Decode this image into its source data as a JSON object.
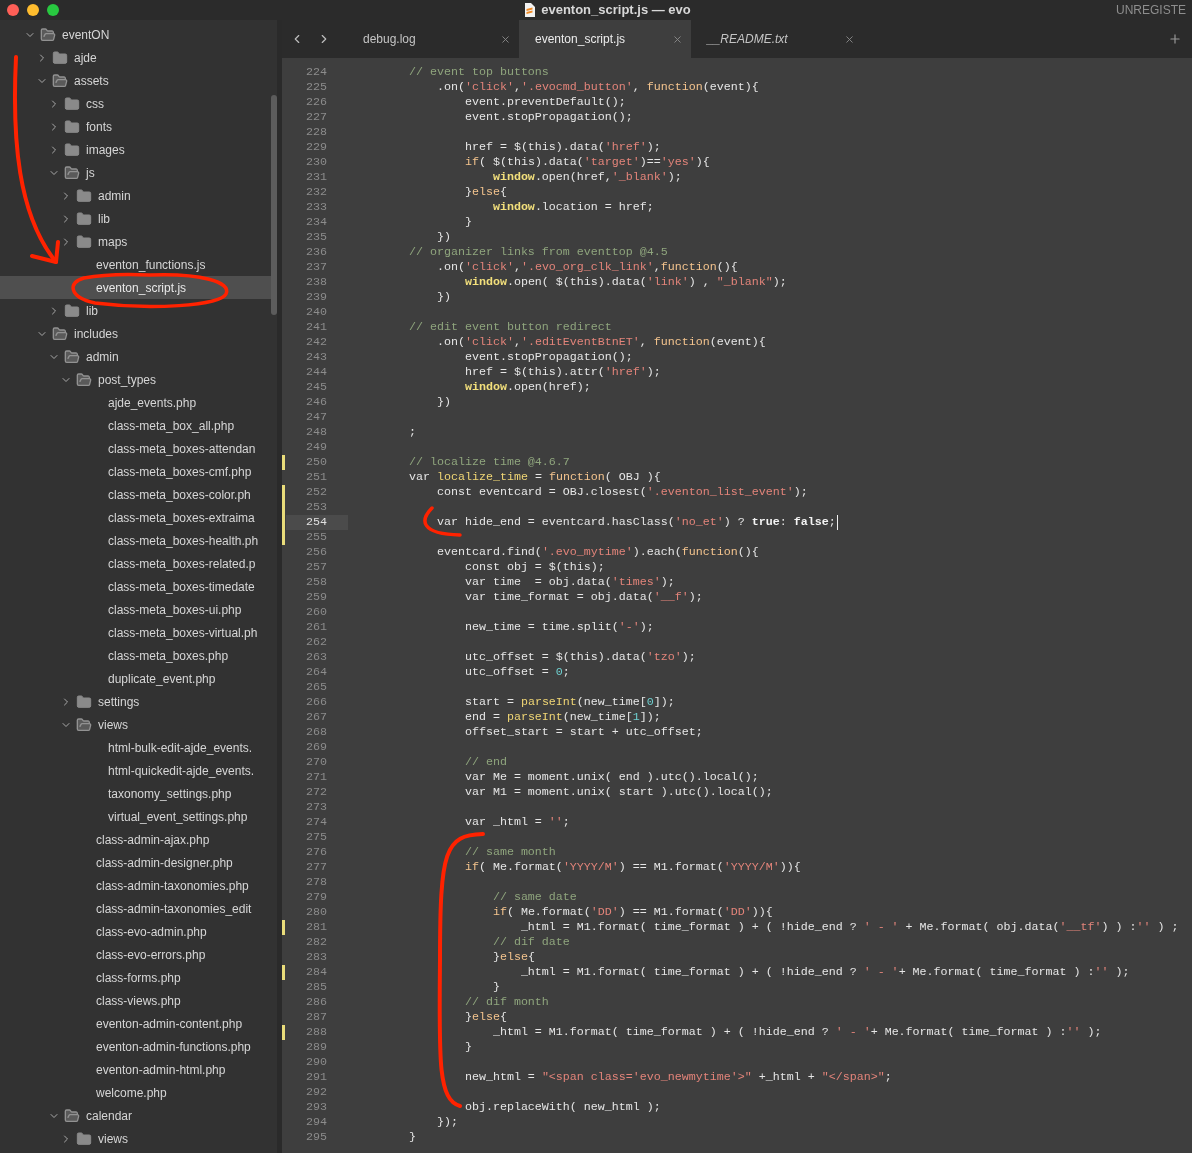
{
  "window": {
    "title": "eventon_script.js — evo",
    "license_notice": "UNREGISTE"
  },
  "tabs": [
    {
      "label": "debug.log",
      "selected": false,
      "preview": false
    },
    {
      "label": "eventon_script.js",
      "selected": true,
      "preview": false
    },
    {
      "label": "__README.txt",
      "selected": false,
      "preview": true
    }
  ],
  "sidebar": {
    "tree": [
      {
        "kind": "folder",
        "label": "eventON",
        "expanded": true,
        "selected": false,
        "children": [
          {
            "kind": "folder",
            "label": "ajde",
            "expanded": false,
            "selected": false
          },
          {
            "kind": "folder",
            "label": "assets",
            "expanded": true,
            "selected": false,
            "children": [
              {
                "kind": "folder",
                "label": "css",
                "expanded": false,
                "selected": false
              },
              {
                "kind": "folder",
                "label": "fonts",
                "expanded": false,
                "selected": false
              },
              {
                "kind": "folder",
                "label": "images",
                "expanded": false,
                "selected": false
              },
              {
                "kind": "folder",
                "label": "js",
                "expanded": true,
                "selected": false,
                "children": [
                  {
                    "kind": "folder",
                    "label": "admin",
                    "expanded": false,
                    "selected": false
                  },
                  {
                    "kind": "folder",
                    "label": "lib",
                    "expanded": false,
                    "selected": false
                  },
                  {
                    "kind": "folder",
                    "label": "maps",
                    "expanded": false,
                    "selected": false
                  },
                  {
                    "kind": "file",
                    "label": "eventon_functions.js",
                    "selected": false
                  },
                  {
                    "kind": "file",
                    "label": "eventon_script.js",
                    "selected": true
                  }
                ]
              },
              {
                "kind": "folder",
                "label": "lib",
                "expanded": false,
                "selected": false
              }
            ]
          },
          {
            "kind": "folder",
            "label": "includes",
            "expanded": true,
            "selected": false,
            "children": [
              {
                "kind": "folder",
                "label": "admin",
                "expanded": true,
                "selected": false,
                "children": [
                  {
                    "kind": "folder",
                    "label": "post_types",
                    "expanded": true,
                    "selected": false,
                    "children": [
                      {
                        "kind": "file",
                        "label": "ajde_events.php",
                        "selected": false
                      },
                      {
                        "kind": "file",
                        "label": "class-meta_box_all.php",
                        "selected": false
                      },
                      {
                        "kind": "file",
                        "label": "class-meta_boxes-attendan",
                        "selected": false
                      },
                      {
                        "kind": "file",
                        "label": "class-meta_boxes-cmf.php",
                        "selected": false
                      },
                      {
                        "kind": "file",
                        "label": "class-meta_boxes-color.ph",
                        "selected": false
                      },
                      {
                        "kind": "file",
                        "label": "class-meta_boxes-extraima",
                        "selected": false
                      },
                      {
                        "kind": "file",
                        "label": "class-meta_boxes-health.ph",
                        "selected": false
                      },
                      {
                        "kind": "file",
                        "label": "class-meta_boxes-related.p",
                        "selected": false
                      },
                      {
                        "kind": "file",
                        "label": "class-meta_boxes-timedate",
                        "selected": false
                      },
                      {
                        "kind": "file",
                        "label": "class-meta_boxes-ui.php",
                        "selected": false
                      },
                      {
                        "kind": "file",
                        "label": "class-meta_boxes-virtual.ph",
                        "selected": false
                      },
                      {
                        "kind": "file",
                        "label": "class-meta_boxes.php",
                        "selected": false
                      },
                      {
                        "kind": "file",
                        "label": "duplicate_event.php",
                        "selected": false
                      }
                    ]
                  },
                  {
                    "kind": "folder",
                    "label": "settings",
                    "expanded": false,
                    "selected": false
                  },
                  {
                    "kind": "folder",
                    "label": "views",
                    "expanded": true,
                    "selected": false,
                    "children": [
                      {
                        "kind": "file",
                        "label": "html-bulk-edit-ajde_events.",
                        "selected": false
                      },
                      {
                        "kind": "file",
                        "label": "html-quickedit-ajde_events.",
                        "selected": false
                      },
                      {
                        "kind": "file",
                        "label": "taxonomy_settings.php",
                        "selected": false
                      },
                      {
                        "kind": "file",
                        "label": "virtual_event_settings.php",
                        "selected": false
                      }
                    ]
                  },
                  {
                    "kind": "file",
                    "label": "class-admin-ajax.php",
                    "selected": false
                  },
                  {
                    "kind": "file",
                    "label": "class-admin-designer.php",
                    "selected": false
                  },
                  {
                    "kind": "file",
                    "label": "class-admin-taxonomies.php",
                    "selected": false
                  },
                  {
                    "kind": "file",
                    "label": "class-admin-taxonomies_edit",
                    "selected": false
                  },
                  {
                    "kind": "file",
                    "label": "class-evo-admin.php",
                    "selected": false
                  },
                  {
                    "kind": "file",
                    "label": "class-evo-errors.php",
                    "selected": false
                  },
                  {
                    "kind": "file",
                    "label": "class-forms.php",
                    "selected": false
                  },
                  {
                    "kind": "file",
                    "label": "class-views.php",
                    "selected": false
                  },
                  {
                    "kind": "file",
                    "label": "eventon-admin-content.php",
                    "selected": false
                  },
                  {
                    "kind": "file",
                    "label": "eventon-admin-functions.php",
                    "selected": false
                  },
                  {
                    "kind": "file",
                    "label": "eventon-admin-html.php",
                    "selected": false
                  },
                  {
                    "kind": "file",
                    "label": "welcome.php",
                    "selected": false
                  }
                ]
              },
              {
                "kind": "folder",
                "label": "calendar",
                "expanded": true,
                "selected": false,
                "children": [
                  {
                    "kind": "folder",
                    "label": "views",
                    "expanded": false,
                    "selected": false
                  }
                ]
              }
            ]
          }
        ]
      }
    ]
  },
  "editor": {
    "lines": [
      {
        "number": "224",
        "modified": false,
        "selected": false,
        "tokens": [
          {
            "text": "        // event top buttons",
            "kind": "comment"
          }
        ]
      },
      {
        "number": "225",
        "modified": false,
        "selected": false,
        "tokens": [
          {
            "text": "            .on(",
            "kind": "plain"
          },
          {
            "text": "'click'",
            "kind": "string"
          },
          {
            "text": ",",
            "kind": "plain"
          },
          {
            "text": "'.evocmd_button'",
            "kind": "string"
          },
          {
            "text": ", ",
            "kind": "plain"
          },
          {
            "text": "function",
            "kind": "keyword"
          },
          {
            "text": "(event){",
            "kind": "plain"
          }
        ]
      },
      {
        "number": "226",
        "modified": false,
        "selected": false,
        "tokens": [
          {
            "text": "                event.preventDefault();",
            "kind": "plain"
          }
        ]
      },
      {
        "number": "227",
        "modified": false,
        "selected": false,
        "tokens": [
          {
            "text": "                event.stopPropagation();",
            "kind": "plain"
          }
        ]
      },
      {
        "number": "228",
        "modified": false,
        "selected": false
      },
      {
        "number": "229",
        "modified": false,
        "selected": false,
        "tokens": [
          {
            "text": "                href = $(this).data(",
            "kind": "plain"
          },
          {
            "text": "'href'",
            "kind": "string"
          },
          {
            "text": ");",
            "kind": "plain"
          }
        ]
      },
      {
        "number": "230",
        "modified": false,
        "selected": false,
        "tokens": [
          {
            "text": "                if",
            "kind": "keyword"
          },
          {
            "text": "( $(this).data(",
            "kind": "plain"
          },
          {
            "text": "'target'",
            "kind": "string"
          },
          {
            "text": ")==",
            "kind": "plain"
          },
          {
            "text": "'yes'",
            "kind": "string"
          },
          {
            "text": "){",
            "kind": "plain"
          }
        ]
      },
      {
        "number": "231",
        "modified": false,
        "selected": false,
        "tokens": [
          {
            "text": "                    window",
            "kind": "builtin"
          },
          {
            "text": ".open(href,",
            "kind": "plain"
          },
          {
            "text": "'_blank'",
            "kind": "string"
          },
          {
            "text": ");",
            "kind": "plain"
          }
        ]
      },
      {
        "number": "232",
        "modified": false,
        "selected": false,
        "tokens": [
          {
            "text": "                }",
            "kind": "plain"
          },
          {
            "text": "else",
            "kind": "keyword"
          },
          {
            "text": "{",
            "kind": "plain"
          }
        ]
      },
      {
        "number": "233",
        "modified": false,
        "selected": false,
        "tokens": [
          {
            "text": "                    window",
            "kind": "builtin"
          },
          {
            "text": ".location = href;",
            "kind": "plain"
          }
        ]
      },
      {
        "number": "234",
        "modified": false,
        "selected": false,
        "tokens": [
          {
            "text": "                }",
            "kind": "plain"
          }
        ]
      },
      {
        "number": "235",
        "modified": false,
        "selected": false,
        "tokens": [
          {
            "text": "            })",
            "kind": "plain"
          }
        ]
      },
      {
        "number": "236",
        "modified": false,
        "selected": false,
        "tokens": [
          {
            "text": "        // organizer links from eventtop @4.5",
            "kind": "comment"
          }
        ]
      },
      {
        "number": "237",
        "modified": false,
        "selected": false,
        "tokens": [
          {
            "text": "            .on(",
            "kind": "plain"
          },
          {
            "text": "'click'",
            "kind": "string"
          },
          {
            "text": ",",
            "kind": "plain"
          },
          {
            "text": "'.evo_org_clk_link'",
            "kind": "string"
          },
          {
            "text": ",",
            "kind": "plain"
          },
          {
            "text": "function",
            "kind": "keyword"
          },
          {
            "text": "(){",
            "kind": "plain"
          }
        ]
      },
      {
        "number": "238",
        "modified": false,
        "selected": false,
        "tokens": [
          {
            "text": "                window",
            "kind": "builtin"
          },
          {
            "text": ".open( $(this).data(",
            "kind": "plain"
          },
          {
            "text": "'link'",
            "kind": "string"
          },
          {
            "text": ") , ",
            "kind": "plain"
          },
          {
            "text": "\"_blank\"",
            "kind": "string"
          },
          {
            "text": ");",
            "kind": "plain"
          }
        ]
      },
      {
        "number": "239",
        "modified": false,
        "selected": false,
        "tokens": [
          {
            "text": "            })",
            "kind": "plain"
          }
        ]
      },
      {
        "number": "240",
        "modified": false,
        "selected": false
      },
      {
        "number": "241",
        "modified": false,
        "selected": false,
        "tokens": [
          {
            "text": "        // edit event button redirect",
            "kind": "comment"
          }
        ]
      },
      {
        "number": "242",
        "modified": false,
        "selected": false,
        "tokens": [
          {
            "text": "            .on(",
            "kind": "plain"
          },
          {
            "text": "'click'",
            "kind": "string"
          },
          {
            "text": ",",
            "kind": "plain"
          },
          {
            "text": "'.editEventBtnET'",
            "kind": "string"
          },
          {
            "text": ", ",
            "kind": "plain"
          },
          {
            "text": "function",
            "kind": "keyword"
          },
          {
            "text": "(event){",
            "kind": "plain"
          }
        ]
      },
      {
        "number": "243",
        "modified": false,
        "selected": false,
        "tokens": [
          {
            "text": "                event.stopPropagation();",
            "kind": "plain"
          }
        ]
      },
      {
        "number": "244",
        "modified": false,
        "selected": false,
        "tokens": [
          {
            "text": "                href = $(this).attr(",
            "kind": "plain"
          },
          {
            "text": "'href'",
            "kind": "string"
          },
          {
            "text": ");",
            "kind": "plain"
          }
        ]
      },
      {
        "number": "245",
        "modified": false,
        "selected": false,
        "tokens": [
          {
            "text": "                window",
            "kind": "builtin"
          },
          {
            "text": ".open(href);",
            "kind": "plain"
          }
        ]
      },
      {
        "number": "246",
        "modified": false,
        "selected": false,
        "tokens": [
          {
            "text": "            })",
            "kind": "plain"
          }
        ]
      },
      {
        "number": "247",
        "modified": false,
        "selected": false
      },
      {
        "number": "248",
        "modified": false,
        "selected": false,
        "tokens": [
          {
            "text": "        ;",
            "kind": "plain"
          }
        ]
      },
      {
        "number": "249",
        "modified": false,
        "selected": false
      },
      {
        "number": "250",
        "modified": true,
        "selected": false,
        "tokens": [
          {
            "text": "        // localize time @4.6.7",
            "kind": "comment"
          }
        ]
      },
      {
        "number": "251",
        "modified": false,
        "selected": false,
        "tokens": [
          {
            "text": "        var ",
            "kind": "plain"
          },
          {
            "text": "localize_time",
            "kind": "function"
          },
          {
            "text": " = ",
            "kind": "plain"
          },
          {
            "text": "function",
            "kind": "keyword"
          },
          {
            "text": "( OBJ ){",
            "kind": "plain"
          }
        ]
      },
      {
        "number": "252",
        "modified": true,
        "selected": false,
        "tokens": [
          {
            "text": "            const eventcard = OBJ.closest(",
            "kind": "plain"
          },
          {
            "text": "'.eventon_list_event'",
            "kind": "string"
          },
          {
            "text": ");",
            "kind": "plain"
          }
        ]
      },
      {
        "number": "253",
        "modified": true,
        "selected": false
      },
      {
        "number": "254",
        "modified": true,
        "selected": true,
        "tokens": [
          {
            "text": "            var hide_end = eventcard.hasClass(",
            "kind": "plain"
          },
          {
            "text": "'no_et'",
            "kind": "string"
          },
          {
            "text": ") ? ",
            "kind": "plain"
          },
          {
            "text": "true",
            "kind": "constant"
          },
          {
            "text": ": ",
            "kind": "plain"
          },
          {
            "text": "false",
            "kind": "constant"
          },
          {
            "text": ";",
            "kind": "plain"
          }
        ]
      },
      {
        "number": "255",
        "modified": true,
        "selected": false
      },
      {
        "number": "256",
        "modified": false,
        "selected": false,
        "tokens": [
          {
            "text": "            eventcard.find(",
            "kind": "plain"
          },
          {
            "text": "'.evo_mytime'",
            "kind": "string"
          },
          {
            "text": ").each(",
            "kind": "plain"
          },
          {
            "text": "function",
            "kind": "keyword"
          },
          {
            "text": "(){",
            "kind": "plain"
          }
        ]
      },
      {
        "number": "257",
        "modified": false,
        "selected": false,
        "tokens": [
          {
            "text": "                const obj = $(this);",
            "kind": "plain"
          }
        ]
      },
      {
        "number": "258",
        "modified": false,
        "selected": false,
        "tokens": [
          {
            "text": "                var time  = obj.data(",
            "kind": "plain"
          },
          {
            "text": "'times'",
            "kind": "string"
          },
          {
            "text": ");",
            "kind": "plain"
          }
        ]
      },
      {
        "number": "259",
        "modified": false,
        "selected": false,
        "tokens": [
          {
            "text": "                var time_format = obj.data(",
            "kind": "plain"
          },
          {
            "text": "'__f'",
            "kind": "string"
          },
          {
            "text": ");",
            "kind": "plain"
          }
        ]
      },
      {
        "number": "260",
        "modified": false,
        "selected": false
      },
      {
        "number": "261",
        "modified": false,
        "selected": false,
        "tokens": [
          {
            "text": "                new_time = time.split(",
            "kind": "plain"
          },
          {
            "text": "'-'",
            "kind": "string"
          },
          {
            "text": ");",
            "kind": "plain"
          }
        ]
      },
      {
        "number": "262",
        "modified": false,
        "selected": false
      },
      {
        "number": "263",
        "modified": false,
        "selected": false,
        "tokens": [
          {
            "text": "                utc_offset = $(this).data(",
            "kind": "plain"
          },
          {
            "text": "'tzo'",
            "kind": "string"
          },
          {
            "text": ");",
            "kind": "plain"
          }
        ]
      },
      {
        "number": "264",
        "modified": false,
        "selected": false,
        "tokens": [
          {
            "text": "                utc_offset = ",
            "kind": "plain"
          },
          {
            "text": "0",
            "kind": "number"
          },
          {
            "text": ";",
            "kind": "plain"
          }
        ]
      },
      {
        "number": "265",
        "modified": false,
        "selected": false
      },
      {
        "number": "266",
        "modified": false,
        "selected": false,
        "tokens": [
          {
            "text": "                start = ",
            "kind": "plain"
          },
          {
            "text": "parseInt",
            "kind": "function"
          },
          {
            "text": "(new_time[",
            "kind": "plain"
          },
          {
            "text": "0",
            "kind": "number"
          },
          {
            "text": "]);",
            "kind": "plain"
          }
        ]
      },
      {
        "number": "267",
        "modified": false,
        "selected": false,
        "tokens": [
          {
            "text": "                end = ",
            "kind": "plain"
          },
          {
            "text": "parseInt",
            "kind": "function"
          },
          {
            "text": "(new_time[",
            "kind": "plain"
          },
          {
            "text": "1",
            "kind": "number"
          },
          {
            "text": "]);",
            "kind": "plain"
          }
        ]
      },
      {
        "number": "268",
        "modified": false,
        "selected": false,
        "tokens": [
          {
            "text": "                offset_start = start + utc_offset;",
            "kind": "plain"
          }
        ]
      },
      {
        "number": "269",
        "modified": false,
        "selected": false
      },
      {
        "number": "270",
        "modified": false,
        "selected": false,
        "tokens": [
          {
            "text": "                // end",
            "kind": "comment"
          }
        ]
      },
      {
        "number": "271",
        "modified": false,
        "selected": false,
        "tokens": [
          {
            "text": "                var Me = moment.unix( end ).utc().local();",
            "kind": "plain"
          }
        ]
      },
      {
        "number": "272",
        "modified": false,
        "selected": false,
        "tokens": [
          {
            "text": "                var M1 = moment.unix( start ).utc().local();",
            "kind": "plain"
          }
        ]
      },
      {
        "number": "273",
        "modified": false,
        "selected": false
      },
      {
        "number": "274",
        "modified": false,
        "selected": false,
        "tokens": [
          {
            "text": "                var _html = ",
            "kind": "plain"
          },
          {
            "text": "''",
            "kind": "string"
          },
          {
            "text": ";",
            "kind": "plain"
          }
        ]
      },
      {
        "number": "275",
        "modified": false,
        "selected": false
      },
      {
        "number": "276",
        "modified": false,
        "selected": false,
        "tokens": [
          {
            "text": "                // same month",
            "kind": "comment"
          }
        ]
      },
      {
        "number": "277",
        "modified": false,
        "selected": false,
        "tokens": [
          {
            "text": "                if",
            "kind": "keyword"
          },
          {
            "text": "( Me.format(",
            "kind": "plain"
          },
          {
            "text": "'YYYY/M'",
            "kind": "string"
          },
          {
            "text": ") == M1.format(",
            "kind": "plain"
          },
          {
            "text": "'YYYY/M'",
            "kind": "string"
          },
          {
            "text": ")){",
            "kind": "plain"
          }
        ]
      },
      {
        "number": "278",
        "modified": false,
        "selected": false
      },
      {
        "number": "279",
        "modified": false,
        "selected": false,
        "tokens": [
          {
            "text": "                    // same date",
            "kind": "comment"
          }
        ]
      },
      {
        "number": "280",
        "modified": false,
        "selected": false,
        "tokens": [
          {
            "text": "                    if",
            "kind": "keyword"
          },
          {
            "text": "( Me.format(",
            "kind": "plain"
          },
          {
            "text": "'DD'",
            "kind": "string"
          },
          {
            "text": ") == M1.format(",
            "kind": "plain"
          },
          {
            "text": "'DD'",
            "kind": "string"
          },
          {
            "text": ")){",
            "kind": "plain"
          }
        ]
      },
      {
        "number": "281",
        "modified": true,
        "selected": false,
        "tokens": [
          {
            "text": "                        _html = M1.format( time_format ) + ( !hide_end ? ",
            "kind": "plain"
          },
          {
            "text": "' - '",
            "kind": "string"
          },
          {
            "text": " + Me.format( obj.data(",
            "kind": "plain"
          },
          {
            "text": "'__tf'",
            "kind": "string"
          },
          {
            "text": ") ) :",
            "kind": "plain"
          },
          {
            "text": "''",
            "kind": "string"
          },
          {
            "text": " ) ;",
            "kind": "plain"
          }
        ]
      },
      {
        "number": "282",
        "modified": false,
        "selected": false,
        "tokens": [
          {
            "text": "                    // dif date",
            "kind": "comment"
          }
        ]
      },
      {
        "number": "283",
        "modified": false,
        "selected": false,
        "tokens": [
          {
            "text": "                    }",
            "kind": "plain"
          },
          {
            "text": "else",
            "kind": "keyword"
          },
          {
            "text": "{",
            "kind": "plain"
          }
        ]
      },
      {
        "number": "284",
        "modified": true,
        "selected": false,
        "tokens": [
          {
            "text": "                        _html = M1.format( time_format ) + ( !hide_end ? ",
            "kind": "plain"
          },
          {
            "text": "' - '",
            "kind": "string"
          },
          {
            "text": "+ Me.format( time_format ) :",
            "kind": "plain"
          },
          {
            "text": "''",
            "kind": "string"
          },
          {
            "text": " );",
            "kind": "plain"
          }
        ]
      },
      {
        "number": "285",
        "modified": false,
        "selected": false,
        "tokens": [
          {
            "text": "                    }",
            "kind": "plain"
          }
        ]
      },
      {
        "number": "286",
        "modified": false,
        "selected": false,
        "tokens": [
          {
            "text": "                // dif month",
            "kind": "comment"
          }
        ]
      },
      {
        "number": "287",
        "modified": false,
        "selected": false,
        "tokens": [
          {
            "text": "                }",
            "kind": "plain"
          },
          {
            "text": "else",
            "kind": "keyword"
          },
          {
            "text": "{",
            "kind": "plain"
          }
        ]
      },
      {
        "number": "288",
        "modified": true,
        "selected": false,
        "tokens": [
          {
            "text": "                    _html = M1.format( time_format ) + ( !hide_end ? ",
            "kind": "plain"
          },
          {
            "text": "' - '",
            "kind": "string"
          },
          {
            "text": "+ Me.format( time_format ) :",
            "kind": "plain"
          },
          {
            "text": "''",
            "kind": "string"
          },
          {
            "text": " );",
            "kind": "plain"
          }
        ]
      },
      {
        "number": "289",
        "modified": false,
        "selected": false,
        "tokens": [
          {
            "text": "                }",
            "kind": "plain"
          }
        ]
      },
      {
        "number": "290",
        "modified": false,
        "selected": false
      },
      {
        "number": "291",
        "modified": false,
        "selected": false,
        "tokens": [
          {
            "text": "                new_html = ",
            "kind": "plain"
          },
          {
            "text": "\"<span class='evo_newmytime'>\"",
            "kind": "string"
          },
          {
            "text": " +_html + ",
            "kind": "plain"
          },
          {
            "text": "\"</span>\"",
            "kind": "string"
          },
          {
            "text": ";",
            "kind": "plain"
          }
        ]
      },
      {
        "number": "292",
        "modified": false,
        "selected": false
      },
      {
        "number": "293",
        "modified": false,
        "selected": false,
        "tokens": [
          {
            "text": "                obj.replaceWith( new_html );",
            "kind": "plain"
          }
        ]
      },
      {
        "number": "294",
        "modified": false,
        "selected": false,
        "tokens": [
          {
            "text": "            });",
            "kind": "plain"
          }
        ]
      },
      {
        "number": "295",
        "modified": false,
        "selected": false,
        "tokens": [
          {
            "text": "        }",
            "kind": "plain"
          }
        ]
      }
    ]
  }
}
